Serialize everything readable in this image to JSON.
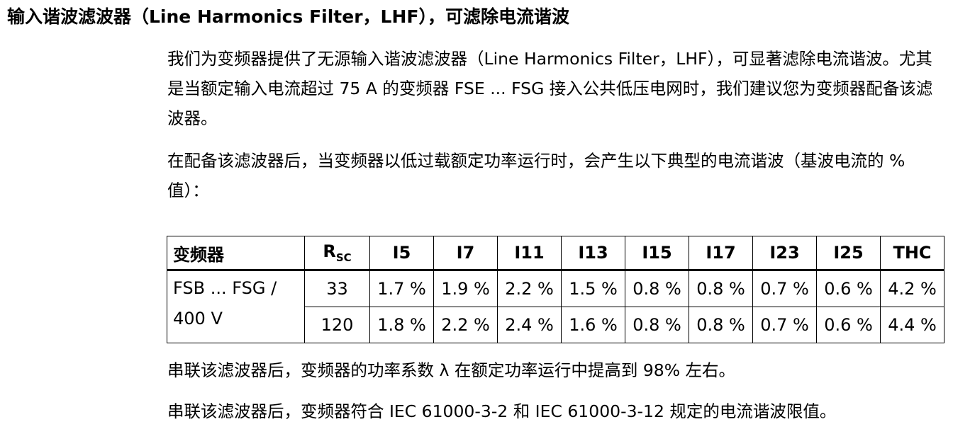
{
  "heading": "输入谐波滤波器（Line Harmonics Filter，LHF），可滤除电流谐波",
  "paragraphs": {
    "p1": "我们为变频器提供了无源输入谐波滤波器（Line Harmonics Filter，LHF），可显著滤除电流谐波。尤其是当额定输入电流超过 75 A 的变频器 FSE ... FSG 接入公共低压电网时，我们建议您为变频器配备该滤波器。",
    "p2": "在配备该滤波器后，当变频器以低过载额定功率运行时，会产生以下典型的电流谐波（基波电流的 % 值）：",
    "p3": "串联该滤波器后，变频器的功率系数 λ 在额定功率运行中提高到 98% 左右。",
    "p4": "串联该滤波器后，变频器符合 IEC 61000-3-2 和 IEC 61000-3-12 规定的电流谐波限值。"
  },
  "table": {
    "header": {
      "device": "变频器",
      "rsc_main": "R",
      "rsc_sub": "SC",
      "cols": [
        "I5",
        "I7",
        "I11",
        "I13",
        "I15",
        "I17",
        "I23",
        "I25",
        "THC"
      ]
    },
    "device_line1": "FSB ... FSG /",
    "device_line2": "400 V",
    "rows": [
      {
        "rsc": "33",
        "values": [
          "1.7 %",
          "1.9 %",
          "2.2 %",
          "1.5 %",
          "0.8 %",
          "0.8 %",
          "0.7 %",
          "0.6 %",
          "4.2 %"
        ]
      },
      {
        "rsc": "120",
        "values": [
          "1.8 %",
          "2.2 %",
          "2.4 %",
          "1.6 %",
          "0.8 %",
          "0.8 %",
          "0.7 %",
          "0.6 %",
          "4.4 %"
        ]
      }
    ]
  }
}
